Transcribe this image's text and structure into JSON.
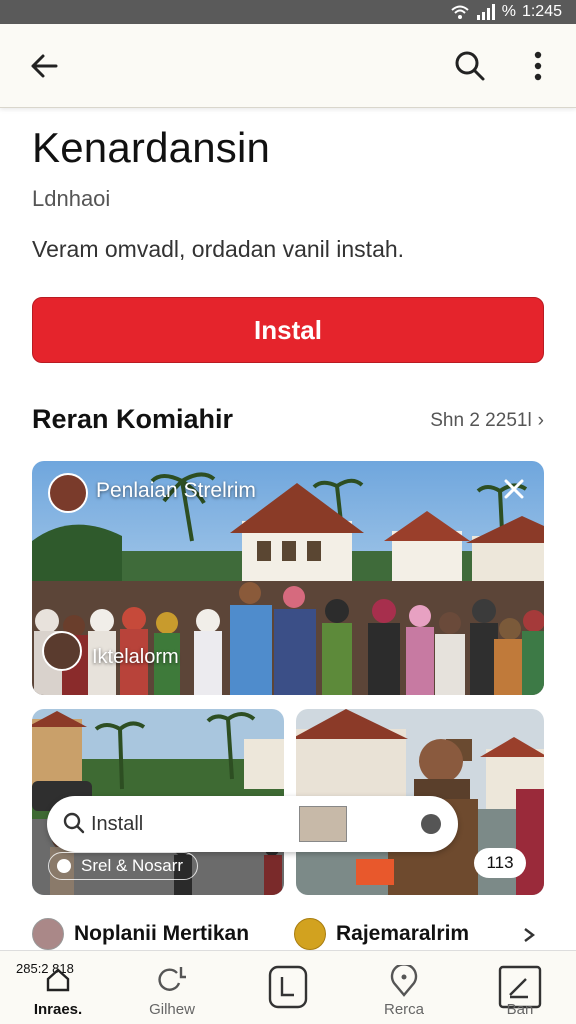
{
  "status_bar": {
    "time": "1:245",
    "battery": "%"
  },
  "app_bar": {
    "back_icon": "arrow-left-icon",
    "search_icon": "search-icon",
    "more_icon": "more-vert-icon"
  },
  "app": {
    "title": "Kenardansin",
    "subtitle": "Ldnhaoi",
    "description": "Veram omvadl, ordadan vanil instah.",
    "install_label": "Instal"
  },
  "section": {
    "title": "Reran Komiahir",
    "link": "Shn 2 2251l",
    "link_chevron": "›"
  },
  "cards": {
    "main": {
      "title": "Penlaian Strelrim",
      "label": "Iktelalorm",
      "close_icon": "close-icon"
    },
    "search_pill": {
      "text": "Install"
    },
    "left_caption": "Srel & Nosarr",
    "count_badge": "113"
  },
  "list": {
    "items": [
      {
        "label": "Noplanii Mertikan"
      },
      {
        "label": "Rajemaralrim"
      }
    ],
    "chevron": "›"
  },
  "bottom_nav": {
    "stamp": "285:2 818",
    "items": [
      {
        "label": "Inraes.",
        "icon": "home-icon"
      },
      {
        "label": "Gilhew",
        "icon": "refresh-icon"
      },
      {
        "label": "",
        "icon": "library-icon"
      },
      {
        "label": "Rerca",
        "icon": "location-icon"
      },
      {
        "label": "Ban",
        "icon": "edit-icon"
      }
    ]
  },
  "colors": {
    "install_red": "#e5242c",
    "app_bar_bg": "#fbfaf5"
  }
}
